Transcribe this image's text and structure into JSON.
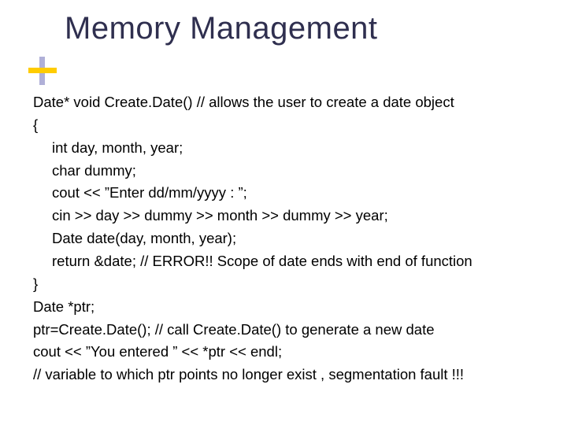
{
  "title": "Memory Management",
  "code": {
    "l1": "Date* void Create.Date()  // allows the user to create a date object",
    "l2": "{",
    "l3": "int day, month, year;",
    "l4": "char dummy;",
    "l5": "cout << ”Enter dd/mm/yyyy : ”;",
    "l6": "cin >> day >> dummy >> month >> dummy >> year;",
    "l7": "Date date(day, month, year);",
    "l8": "return &date;    // ERROR!!  Scope of date ends with end of function",
    "l9": "}",
    "l10": "Date *ptr;",
    "l11": "ptr=Create.Date(); // call Create.Date() to generate a new date",
    "l12": "cout << ”You entered ” << *ptr << endl;",
    "l13": "// variable to which ptr points no longer exist , segmentation fault !!!"
  }
}
